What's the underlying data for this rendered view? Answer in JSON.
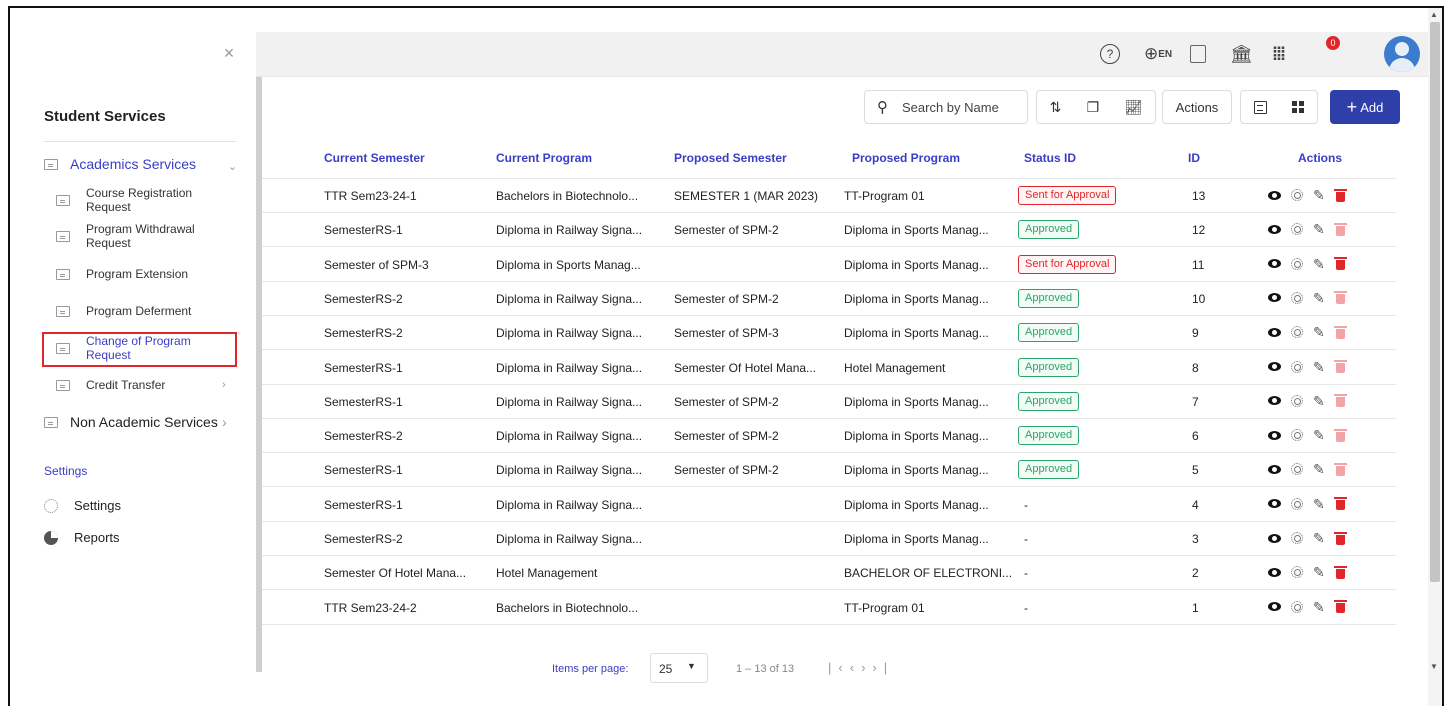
{
  "sidebar": {
    "title": "Student Services",
    "academics": {
      "label": "Academics Services",
      "chevron": "v"
    },
    "children": [
      {
        "label1": "Course Registration",
        "label2": "Request"
      },
      {
        "label1": "Program Withdrawal",
        "label2": "Request"
      },
      {
        "label1": "Program Extension",
        "label2": ""
      },
      {
        "label1": "Program Deferment",
        "label2": ""
      },
      {
        "label1": "Change of Program",
        "label2": "Request"
      },
      {
        "label1": "Credit Transfer",
        "label2": ""
      }
    ],
    "non_academic": {
      "label": "Non Academic Services"
    },
    "settings_section": "Settings",
    "settings_item": "Settings",
    "reports_item": "Reports",
    "close_icon": "close-icon",
    "highlight_color": "#e0262b"
  },
  "topbar": {
    "lang_code": "EN",
    "notification_count": "0",
    "icons": [
      "help-icon",
      "language-icon",
      "document-icon",
      "institution-icon",
      "apps-grid-icon",
      "bell-icon",
      "avatar"
    ]
  },
  "toolbar": {
    "search_placeholder": "Search by Name",
    "actions_label": "Actions",
    "add_label": "Add",
    "accent_color": "#2f3faa"
  },
  "table": {
    "headers": {
      "current_semester": "Current Semester",
      "current_program": "Current Program",
      "proposed_semester": "Proposed Semester",
      "proposed_program": "Proposed Program",
      "status": "Status ID",
      "id": "ID",
      "actions": "Actions"
    },
    "rows": [
      {
        "cur_sem": "TTR Sem23-24-1",
        "cur_prog": "Bachelors in Biotechnolo...",
        "prop_sem": "SEMESTER 1 (MAR 2023)",
        "prop_prog": "TT-Program 01",
        "status": "Sent for Approval",
        "status_color": "red",
        "id": "13",
        "delete_enabled": true
      },
      {
        "cur_sem": "SemesterRS-1",
        "cur_prog": "Diploma in Railway Signa...",
        "prop_sem": "Semester of SPM-2",
        "prop_prog": "Diploma in Sports Manag...",
        "status": "Approved",
        "status_color": "green",
        "id": "12",
        "delete_enabled": false
      },
      {
        "cur_sem": "Semester of SPM-3",
        "cur_prog": "Diploma in Sports Manag...",
        "prop_sem": "",
        "prop_prog": "Diploma in Sports Manag...",
        "status": "Sent for Approval",
        "status_color": "red",
        "id": "11",
        "delete_enabled": true
      },
      {
        "cur_sem": "SemesterRS-2",
        "cur_prog": "Diploma in Railway Signa...",
        "prop_sem": "Semester of SPM-2",
        "prop_prog": "Diploma in Sports Manag...",
        "status": "Approved",
        "status_color": "green",
        "id": "10",
        "delete_enabled": false
      },
      {
        "cur_sem": "SemesterRS-2",
        "cur_prog": "Diploma in Railway Signa...",
        "prop_sem": "Semester of SPM-3",
        "prop_prog": "Diploma in Sports Manag...",
        "status": "Approved",
        "status_color": "green",
        "id": "9",
        "delete_enabled": false
      },
      {
        "cur_sem": "SemesterRS-1",
        "cur_prog": "Diploma in Railway Signa...",
        "prop_sem": "Semester Of Hotel Mana...",
        "prop_prog": "Hotel Management",
        "status": "Approved",
        "status_color": "green",
        "id": "8",
        "delete_enabled": false
      },
      {
        "cur_sem": "SemesterRS-1",
        "cur_prog": "Diploma in Railway Signa...",
        "prop_sem": "Semester of SPM-2",
        "prop_prog": "Diploma in Sports Manag...",
        "status": "Approved",
        "status_color": "green",
        "id": "7",
        "delete_enabled": false
      },
      {
        "cur_sem": "SemesterRS-2",
        "cur_prog": "Diploma in Railway Signa...",
        "prop_sem": "Semester of SPM-2",
        "prop_prog": "Diploma in Sports Manag...",
        "status": "Approved",
        "status_color": "green",
        "id": "6",
        "delete_enabled": false
      },
      {
        "cur_sem": "SemesterRS-1",
        "cur_prog": "Diploma in Railway Signa...",
        "prop_sem": "Semester of SPM-2",
        "prop_prog": "Diploma in Sports Manag...",
        "status": "Approved",
        "status_color": "green",
        "id": "5",
        "delete_enabled": false
      },
      {
        "cur_sem": "SemesterRS-1",
        "cur_prog": "Diploma in Railway Signa...",
        "prop_sem": "",
        "prop_prog": "Diploma in Sports Manag...",
        "status": "-",
        "status_color": "none",
        "id": "4",
        "delete_enabled": true
      },
      {
        "cur_sem": "SemesterRS-2",
        "cur_prog": "Diploma in Railway Signa...",
        "prop_sem": "",
        "prop_prog": "Diploma in Sports Manag...",
        "status": "-",
        "status_color": "none",
        "id": "3",
        "delete_enabled": true
      },
      {
        "cur_sem": "Semester Of Hotel Mana...",
        "cur_prog": "Hotel Management",
        "prop_sem": "",
        "prop_prog": "BACHELOR OF ELECTRONI...",
        "status": "-",
        "status_color": "none",
        "id": "2",
        "delete_enabled": true
      },
      {
        "cur_sem": "TTR Sem23-24-2",
        "cur_prog": "Bachelors in Biotechnolo...",
        "prop_sem": "",
        "prop_prog": "TT-Program 01",
        "status": "-",
        "status_color": "none",
        "id": "1",
        "delete_enabled": true
      }
    ]
  },
  "footer": {
    "items_per_page_label": "Items per page:",
    "items_per_page_value": "25",
    "range": "1 – 13 of 13"
  }
}
